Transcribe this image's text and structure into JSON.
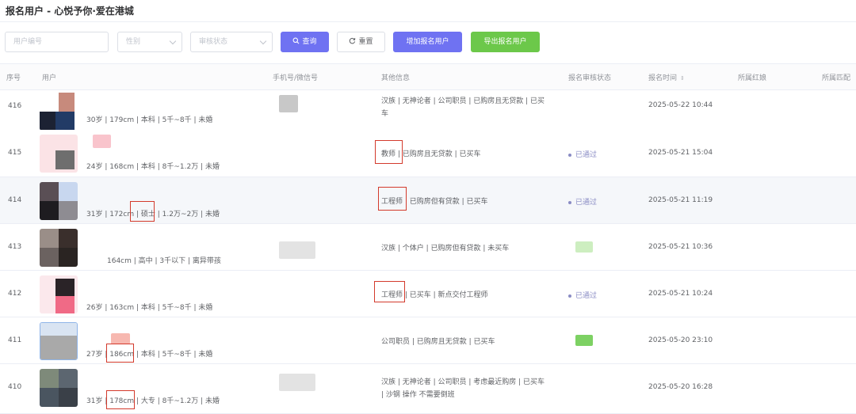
{
  "page": {
    "title": "报名用户 - 心悦予你·爱在港城"
  },
  "filters": {
    "user_id_placeholder": "用户编号",
    "gender_placeholder": "性别",
    "review_status_placeholder": "审核状态"
  },
  "buttons": {
    "query": "查询",
    "reset": "重置",
    "add": "增加报名用户",
    "export": "导出报名用户"
  },
  "icons": {
    "query": "search-icon",
    "reset": "refresh-icon",
    "sort": "sort-icon"
  },
  "colors": {
    "primary": "#6f72f2",
    "success": "#6cc84a",
    "highlight_box": "#d33a2c",
    "status_text": "#8a8cc4"
  },
  "columns": [
    "序号",
    "用户",
    "手机号/微信号",
    "其他信息",
    "报名审核状态",
    "报名时间",
    "所属红娘",
    "所属匹配"
  ],
  "rows": [
    {
      "id": "416",
      "profile": "30岁 | 179cm | 本科 | 5千~8千 | 未婚",
      "other_line1": "汉族 | 无神论者 | 公司职员 | 已购房且无贷款 | 已买",
      "other_line2": "车",
      "status": "",
      "time": "2025-05-22 10:44"
    },
    {
      "id": "415",
      "profile": "24岁 | 168cm | 本科 | 8千~1.2万 | 未婚",
      "other_hl": "教师",
      "other_rest": " | 已购房且无贷款 | 已买车",
      "status": "已通过",
      "time": "2025-05-21 15:04"
    },
    {
      "id": "414",
      "profile_a": "31岁 | 172cm | ",
      "profile_hl": "硕士",
      "profile_b": " | 1.2万~2万 | 未婚",
      "other_hl": "工程师",
      "other_rest": " | 已购房但有贷款 | 已买车",
      "status": "已通过",
      "time": "2025-05-21 11:19"
    },
    {
      "id": "413",
      "profile": "164cm | 高中 | 3千以下 | 离异带孩",
      "other": "汉族 | 个体户 | 已购房但有贷款 | 未买车",
      "status": "",
      "time": "2025-05-21 10:36"
    },
    {
      "id": "412",
      "profile": "26岁 | 163cm | 本科 | 5千~8千 | 未婚",
      "other_hl": "工程师",
      "other_rest": " | 已买车 | 新点交付工程师",
      "status": "已通过",
      "time": "2025-05-21 10:24"
    },
    {
      "id": "411",
      "profile_a": "27岁 | ",
      "profile_hl": "186cm",
      "profile_b": " | 本科 | 5千~8千 | 未婚",
      "other": "公司职员 | 已购房且无贷款 | 已买车",
      "status": "",
      "time": "2025-05-20 23:10"
    },
    {
      "id": "410",
      "profile_a": "31岁 | ",
      "profile_hl": "178cm",
      "profile_b": " | 大专 | 8千~1.2万 | 未婚",
      "other_line1": "汉族 | 无神论者 | 公司职员 | 考虑最近购房 | 已买车",
      "other_line2": " | 沙钢 操作 不需要倒班",
      "status": "",
      "time": "2025-05-20 16:28"
    }
  ]
}
